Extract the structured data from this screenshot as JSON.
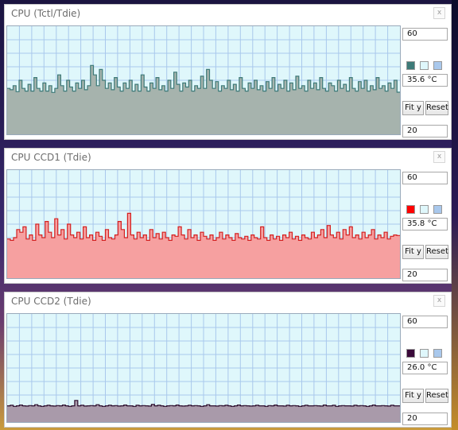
{
  "panels": [
    {
      "title": "CPU (Tctl/Tdie)",
      "close_label": "x",
      "max_label": "60",
      "min_label": "20",
      "current_value": "35.6 °C",
      "fit_label": "Fit y",
      "reset_label": "Reset",
      "line_color": "#3d7a78",
      "fill_color": "#a6b3ad",
      "swatch_colors": [
        "#3d7a78",
        "#dff7fb",
        "#a9c8ec"
      ]
    },
    {
      "title": "CPU CCD1 (Tdie)",
      "close_label": "x",
      "max_label": "60",
      "min_label": "20",
      "current_value": "35.8 °C",
      "fit_label": "Fit y",
      "reset_label": "Reset",
      "line_color": "#d42020",
      "fill_color": "#f6a0a0",
      "swatch_colors": [
        "#ff0000",
        "#dff7fb",
        "#a9c8ec"
      ]
    },
    {
      "title": "CPU CCD2 (Tdie)",
      "close_label": "x",
      "max_label": "60",
      "min_label": "20",
      "current_value": "26.0 °C",
      "fit_label": "Fit y",
      "reset_label": "Reset",
      "line_color": "#2a0a2a",
      "fill_color": "#a99aaa",
      "swatch_colors": [
        "#3a0a3a",
        "#dff7fb",
        "#a9c8ec"
      ]
    }
  ],
  "chart_data": [
    {
      "type": "area",
      "title": "CPU (Tctl/Tdie)",
      "ylim": [
        20,
        60
      ],
      "grid": true,
      "values": [
        37,
        36.5,
        38,
        35.8,
        40,
        37,
        36,
        38.5,
        36,
        41,
        37,
        36,
        39,
        36,
        38,
        35.5,
        37,
        42,
        38,
        36,
        40,
        37.5,
        36,
        39,
        37,
        40,
        36.5,
        38,
        45.5,
        42,
        38,
        44,
        40,
        37,
        39,
        36.5,
        41,
        37.5,
        36,
        39,
        37,
        40,
        36,
        38.5,
        36,
        42,
        37.5,
        36,
        39,
        37,
        41,
        36.5,
        38,
        36,
        40,
        37,
        43,
        38.5,
        36,
        39,
        37.5,
        40,
        36,
        38,
        37,
        41.5,
        37,
        44,
        40,
        37,
        39.5,
        36,
        38,
        37,
        40,
        36.5,
        38.5,
        36,
        41,
        37,
        36,
        39,
        37,
        40,
        36.5,
        38,
        36,
        39.5,
        37,
        41,
        36,
        38.5,
        37,
        40,
        36,
        39,
        36.5,
        41.5,
        37,
        38,
        36,
        40,
        37,
        39,
        36.5,
        41,
        37,
        36,
        39,
        38,
        36,
        40,
        37,
        38.5,
        36,
        41,
        37,
        36,
        39.5,
        37,
        40,
        36,
        38,
        36.5,
        41,
        37,
        38,
        36,
        39,
        37,
        40,
        35.6
      ]
    },
    {
      "type": "area",
      "title": "CPU CCD1 (Tdie)",
      "ylim": [
        20,
        60
      ],
      "grid": true,
      "values": [
        34.5,
        34,
        35,
        38,
        37,
        39,
        34.5,
        36,
        34,
        40,
        36,
        35,
        41,
        37,
        35,
        42,
        36,
        38,
        34.5,
        40,
        36,
        35,
        37,
        34.5,
        39,
        35,
        36,
        34,
        37,
        35.5,
        34,
        38,
        35,
        34.5,
        36,
        41,
        38,
        35,
        44,
        36,
        34.5,
        37,
        35,
        36,
        34,
        38,
        35,
        36.5,
        34.5,
        37,
        35,
        34,
        36,
        35.5,
        39,
        36,
        34.5,
        38,
        35,
        36,
        34,
        37,
        35.5,
        34.5,
        36,
        34,
        35,
        37,
        34.5,
        36,
        35,
        34,
        36.5,
        35,
        34.5,
        35.5,
        34,
        36,
        35,
        34.5,
        39,
        35,
        34,
        36,
        34.5,
        35.5,
        34,
        36,
        35,
        37,
        34.5,
        35.5,
        34,
        36,
        35,
        34.5,
        37,
        35,
        36,
        38,
        35,
        39.5,
        36,
        35,
        37,
        34.5,
        38,
        36,
        39,
        35,
        36,
        34.5,
        37,
        35,
        36,
        38,
        34.5,
        36,
        35,
        37,
        34.5,
        35.5,
        36,
        35.8
      ]
    },
    {
      "type": "area",
      "title": "CPU CCD2 (Tdie)",
      "ylim": [
        20,
        60
      ],
      "grid": true,
      "values": [
        26,
        26.2,
        25.8,
        26,
        26.3,
        26,
        25.9,
        26.1,
        26,
        26.4,
        26,
        25.8,
        26,
        26.2,
        26,
        25.9,
        26.1,
        26,
        26.3,
        26,
        25.8,
        26,
        28,
        26,
        26.2,
        25.9,
        26,
        26.1,
        26,
        26.4,
        26,
        25.8,
        26,
        26.2,
        26,
        26.1,
        25.9,
        26,
        26.3,
        26,
        26,
        25.8,
        26.2,
        26,
        26.1,
        26,
        25.9,
        26.5,
        26,
        26.2,
        26,
        25.8,
        26,
        26.1,
        26,
        26.3,
        26,
        25.9,
        26,
        26.2,
        26,
        26.1,
        26,
        25.8,
        26,
        26.4,
        26,
        26,
        25.9,
        26.1,
        26,
        26.2,
        26,
        25.8,
        26,
        26.3,
        26,
        26.1,
        26,
        25.9,
        26,
        26.2,
        26,
        26,
        25.8,
        26.1,
        26,
        26.3,
        26,
        26,
        25.9,
        26.2,
        26,
        26.1,
        26,
        25.8,
        26,
        26.2,
        26,
        26,
        26.1,
        26,
        25.9,
        26.3,
        26,
        26,
        26.2,
        25.8,
        26,
        26.1,
        26,
        26,
        25.9,
        26.2,
        26,
        26.1,
        26,
        25.8,
        26,
        26.3,
        26,
        26,
        26.1,
        26,
        25.9,
        26.2,
        26,
        26
      ]
    }
  ]
}
